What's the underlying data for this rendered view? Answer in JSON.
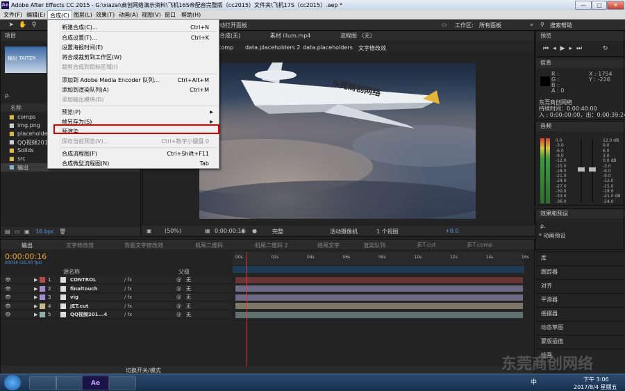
{
  "window": {
    "app_icon": "Ae",
    "title": "Adobe After Effects CC 2015 - G:\\xiazai\\商创网络演示资料\\飞机16S帝配音完整版（cc2015）文件夹\\飞机17S（cc2015）.aep *",
    "minimize": "—",
    "maximize": "□",
    "close": "✕"
  },
  "menubar": [
    "文件(F)",
    "编辑(E)",
    "合成(C)",
    "图层(L)",
    "效果(T)",
    "动画(A)",
    "视图(V)",
    "窗口",
    "帮助(H)"
  ],
  "composition_menu": {
    "items": [
      {
        "label": "新建合成(C)...",
        "shortcut": "Ctrl+N",
        "disabled": false
      },
      {
        "label": "合成设置(T)...",
        "shortcut": "Ctrl+K",
        "disabled": false
      },
      {
        "label": "设置海报时间(E)",
        "shortcut": "",
        "disabled": false
      },
      {
        "label": "将合成裁剪到工作区(W)",
        "shortcut": "",
        "disabled": false
      },
      {
        "label": "裁剪合成到目标区域(I)",
        "shortcut": "",
        "disabled": true
      },
      {
        "label": "添加到 Adobe Media Encoder 队列...",
        "shortcut": "Ctrl+Alt+M",
        "disabled": false
      },
      {
        "label": "添加到渲染队列(A)",
        "shortcut": "Ctrl+M",
        "disabled": false
      },
      {
        "label": "添加输出模块(D)",
        "shortcut": "",
        "disabled": true
      },
      {
        "label": "预览(P)",
        "shortcut": "",
        "disabled": false,
        "submenu": true
      },
      {
        "label": "帧另存为(S)",
        "shortcut": "",
        "disabled": false,
        "submenu": true
      },
      {
        "label": "预渲染...",
        "shortcut": "",
        "disabled": false
      },
      {
        "label": "保存当前预览(V)...",
        "shortcut": "Ctrl+数字小键盘 0",
        "disabled": true
      },
      {
        "label": "合成流程图(F)",
        "shortcut": "Ctrl+Shift+F11",
        "disabled": false
      },
      {
        "label": "合成微型流程图(N)",
        "shortcut": "Tab",
        "disabled": false
      }
    ]
  },
  "toolbar": {
    "open_panel_text": "动打开面板",
    "workspace_label": "工作区:",
    "workspace_value": "所有面板",
    "search_help": "搜索帮助"
  },
  "project_panel": {
    "title": "项目",
    "thumb_caption": "输出 TAITER",
    "search_placeholder": "ρ.",
    "column_name": "名称",
    "items": [
      "comps",
      "img.png",
      "placeholders",
      "QQ视频2016...",
      "Solids",
      "src",
      "输出"
    ],
    "bpc": "16 bpc"
  },
  "comp_tabs": {
    "comp_label": "合成(无)",
    "footage": "素材 illum.mp4",
    "flowchart": "流程图 （无）"
  },
  "breadcrumb": [
    "comp",
    "data.placeholders 2",
    "data.placeholders",
    "文字修改效"
  ],
  "viewer": {
    "logo_text": "东莞商创网络",
    "zoom": "(50%)",
    "timecode": "0:00:00:16",
    "resolution": "完整",
    "camera": "活动摄像机",
    "views": "1 个视图",
    "exposure": "+0.0"
  },
  "preview_panel": {
    "title": "预览"
  },
  "info_panel": {
    "title": "信息",
    "r": "R :",
    "g": "G :",
    "b": "B :",
    "a": "A : 0",
    "x": "X : 1754",
    "y": "Y : -226",
    "comp_name": "东莞商创网络",
    "duration": "持续时间：0:00:40:00",
    "in_out": "入 : 0:00:00:00，出：0:00:39:24"
  },
  "audio_panel": {
    "title": "音频",
    "db_right": [
      "12.0 dB",
      "9.0",
      "6.0",
      "3.0",
      "0.0 dB",
      "-3.0",
      "-6.0",
      "-9.0",
      "-12.0",
      "-15.0",
      "-18.0",
      "-21.0 dB",
      "-24.0"
    ],
    "db_left": [
      "0.0",
      "-3.0",
      "-6.0",
      "-9.0",
      "-12.0",
      "-15.0",
      "-18.0",
      "-21.0",
      "-24.0",
      "-27.0",
      "-30.0",
      "-33.0",
      "-36.0"
    ]
  },
  "effects_panel": {
    "title": "效果和预设",
    "search": "ρ.",
    "item": "* 动画预设"
  },
  "right_panels": [
    "库",
    "跟踪器",
    "对齐",
    "平滑器",
    "摇摆器",
    "动态草图",
    "蒙版插值",
    "绘画"
  ],
  "timeline": {
    "tabs": [
      "输出",
      "文字修改效",
      "背面文字修改效",
      "机尾二维码",
      "机尾二维码 2",
      "结尾文字",
      "渲染队列",
      "JET.cut",
      "JET.comp"
    ],
    "timecode": "0:00:00:16",
    "fps_info": "00016 (25.00 fps)",
    "col_source": "源名称",
    "col_parent": "父级",
    "ruler": [
      "00s",
      "02s",
      "04s",
      "06s",
      "08s",
      "10s",
      "12s",
      "14s",
      "16s"
    ],
    "layers": [
      {
        "num": "1",
        "name": "CONTROL",
        "parent": "无",
        "color": "#c24848",
        "bar": "#6b3434"
      },
      {
        "num": "2",
        "name": "finaltouch",
        "parent": "无",
        "color": "#a58bd0",
        "bar": "#6e6a86"
      },
      {
        "num": "3",
        "name": "vig",
        "parent": "无",
        "color": "#a58bd0",
        "bar": "#6e6a86"
      },
      {
        "num": "4",
        "name": "JET.cut",
        "parent": "无",
        "color": "#c9b78a",
        "bar": "#7f7765"
      },
      {
        "num": "5",
        "name": "QQ视频201...4",
        "parent": "无",
        "color": "#8fb0a8",
        "bar": "#61716d"
      }
    ],
    "toggle_mode": "切换开关/模式",
    "current_time_fraction": 0.04
  },
  "taskbar": {
    "time": "下午 3:06",
    "date": "2017/8/4 星期五",
    "ime": "中"
  },
  "watermark": "东莞商创网络"
}
